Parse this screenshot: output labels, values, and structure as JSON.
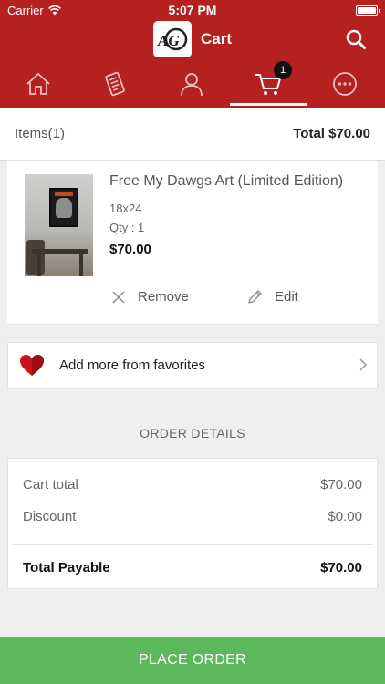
{
  "status_bar": {
    "carrier": "Carrier",
    "time": "5:07 PM"
  },
  "header": {
    "title": "Cart",
    "logo_text": "AG"
  },
  "tabs": [
    {
      "name": "home",
      "icon": "home-icon"
    },
    {
      "name": "catalog",
      "icon": "catalog-icon"
    },
    {
      "name": "profile",
      "icon": "user-icon"
    },
    {
      "name": "cart",
      "icon": "cart-icon",
      "badge": "1",
      "active": true
    },
    {
      "name": "more",
      "icon": "more-icon"
    }
  ],
  "summary": {
    "items_label": "Items(1)",
    "total_label": "Total  $70.00"
  },
  "cart_item": {
    "name": "Free My Dawgs Art (Limited Edition)",
    "size": "18x24",
    "qty": "Qty : 1",
    "price": "$70.00",
    "remove_label": "Remove",
    "edit_label": "Edit"
  },
  "favorites": {
    "label": "Add more from favorites"
  },
  "order_details": {
    "heading": "ORDER DETAILS",
    "cart_total_label": "Cart total",
    "cart_total_value": "$70.00",
    "discount_label": "Discount",
    "discount_value": "$0.00",
    "payable_label": "Total Payable",
    "payable_value": "$70.00"
  },
  "place_order_label": "PLACE ORDER",
  "colors": {
    "brand_red": "#b5211f",
    "place_order_green": "#5cb85c",
    "heart_red": "#c8151b"
  }
}
